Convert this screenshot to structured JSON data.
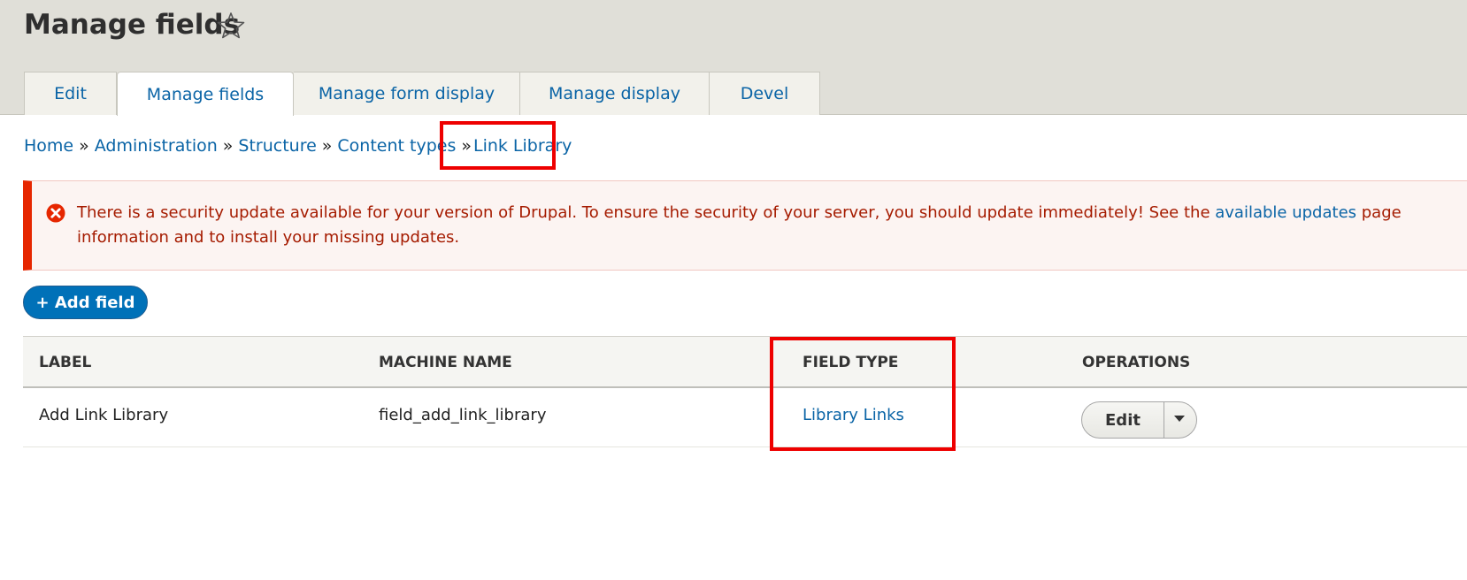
{
  "header": {
    "title": "Manage fields",
    "tabs": [
      {
        "label": "Edit",
        "active": false
      },
      {
        "label": "Manage fields",
        "active": true
      },
      {
        "label": "Manage form display",
        "active": false
      },
      {
        "label": "Manage display",
        "active": false
      },
      {
        "label": "Devel",
        "active": false
      }
    ]
  },
  "breadcrumb": {
    "items": [
      "Home",
      "Administration",
      "Structure",
      "Content types",
      "Link Library"
    ],
    "separator": "»"
  },
  "alert": {
    "line1_before": "There is a security update available for your version of Drupal. To ensure the security of your server, you should update immediately! See the ",
    "link": "available updates",
    "line1_after": " page",
    "line2": "information and to install your missing updates."
  },
  "actions": {
    "add_field": "+ Add field"
  },
  "table": {
    "headers": [
      "LABEL",
      "MACHINE NAME",
      "FIELD TYPE",
      "OPERATIONS"
    ],
    "rows": [
      {
        "label": "Add Link Library",
        "machine_name": "field_add_link_library",
        "field_type": "Library Links",
        "operation": "Edit"
      }
    ]
  },
  "colors": {
    "link": "#0a64a6",
    "primary_button": "#0071b8",
    "alert_border": "#e62600",
    "alert_text": "#a51b00",
    "annotation": "#ee0000"
  },
  "icons": {
    "favorite": "star-icon",
    "error": "error-icon",
    "dropdown": "caret-down-icon"
  }
}
